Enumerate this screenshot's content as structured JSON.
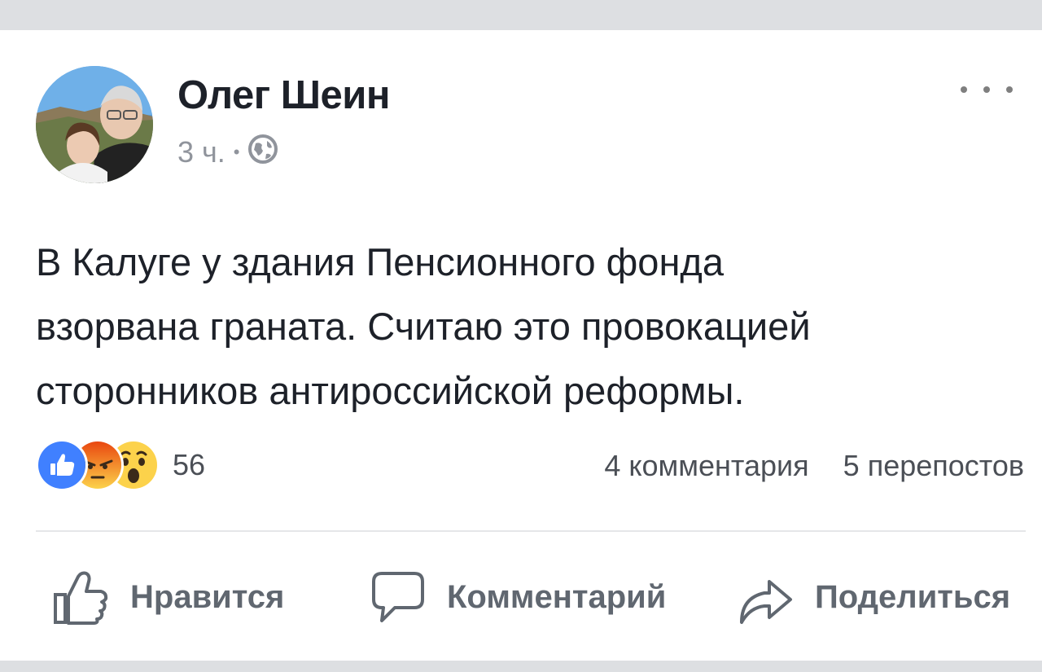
{
  "post": {
    "author": "Олег Шеин",
    "time": "3 ч.",
    "separator": "•",
    "privacy_icon": "globe-icon",
    "more_icon": "more-options-icon",
    "text_lines": [
      "В Калуге у здания Пенсионного фонда",
      "взорвана граната. Считаю это провокацией",
      "сторонников антироссийской реформы."
    ]
  },
  "reactions": {
    "icons": [
      "like-reaction-icon",
      "angry-reaction-icon",
      "wow-reaction-icon"
    ],
    "count": "56"
  },
  "stats": {
    "comments": "4 комментария",
    "shares": "5 перепостов"
  },
  "actions": {
    "like": "Нравится",
    "comment": "Комментарий",
    "share": "Поделиться"
  },
  "colors": {
    "background": "#dddfe2",
    "card": "#ffffff",
    "text": "#1d2129",
    "secondary_text": "#90949c",
    "action_text": "#606770",
    "like_blue": "#4080ff",
    "angry_orange": "#e9710f",
    "wow_yellow": "#fcd24b"
  }
}
